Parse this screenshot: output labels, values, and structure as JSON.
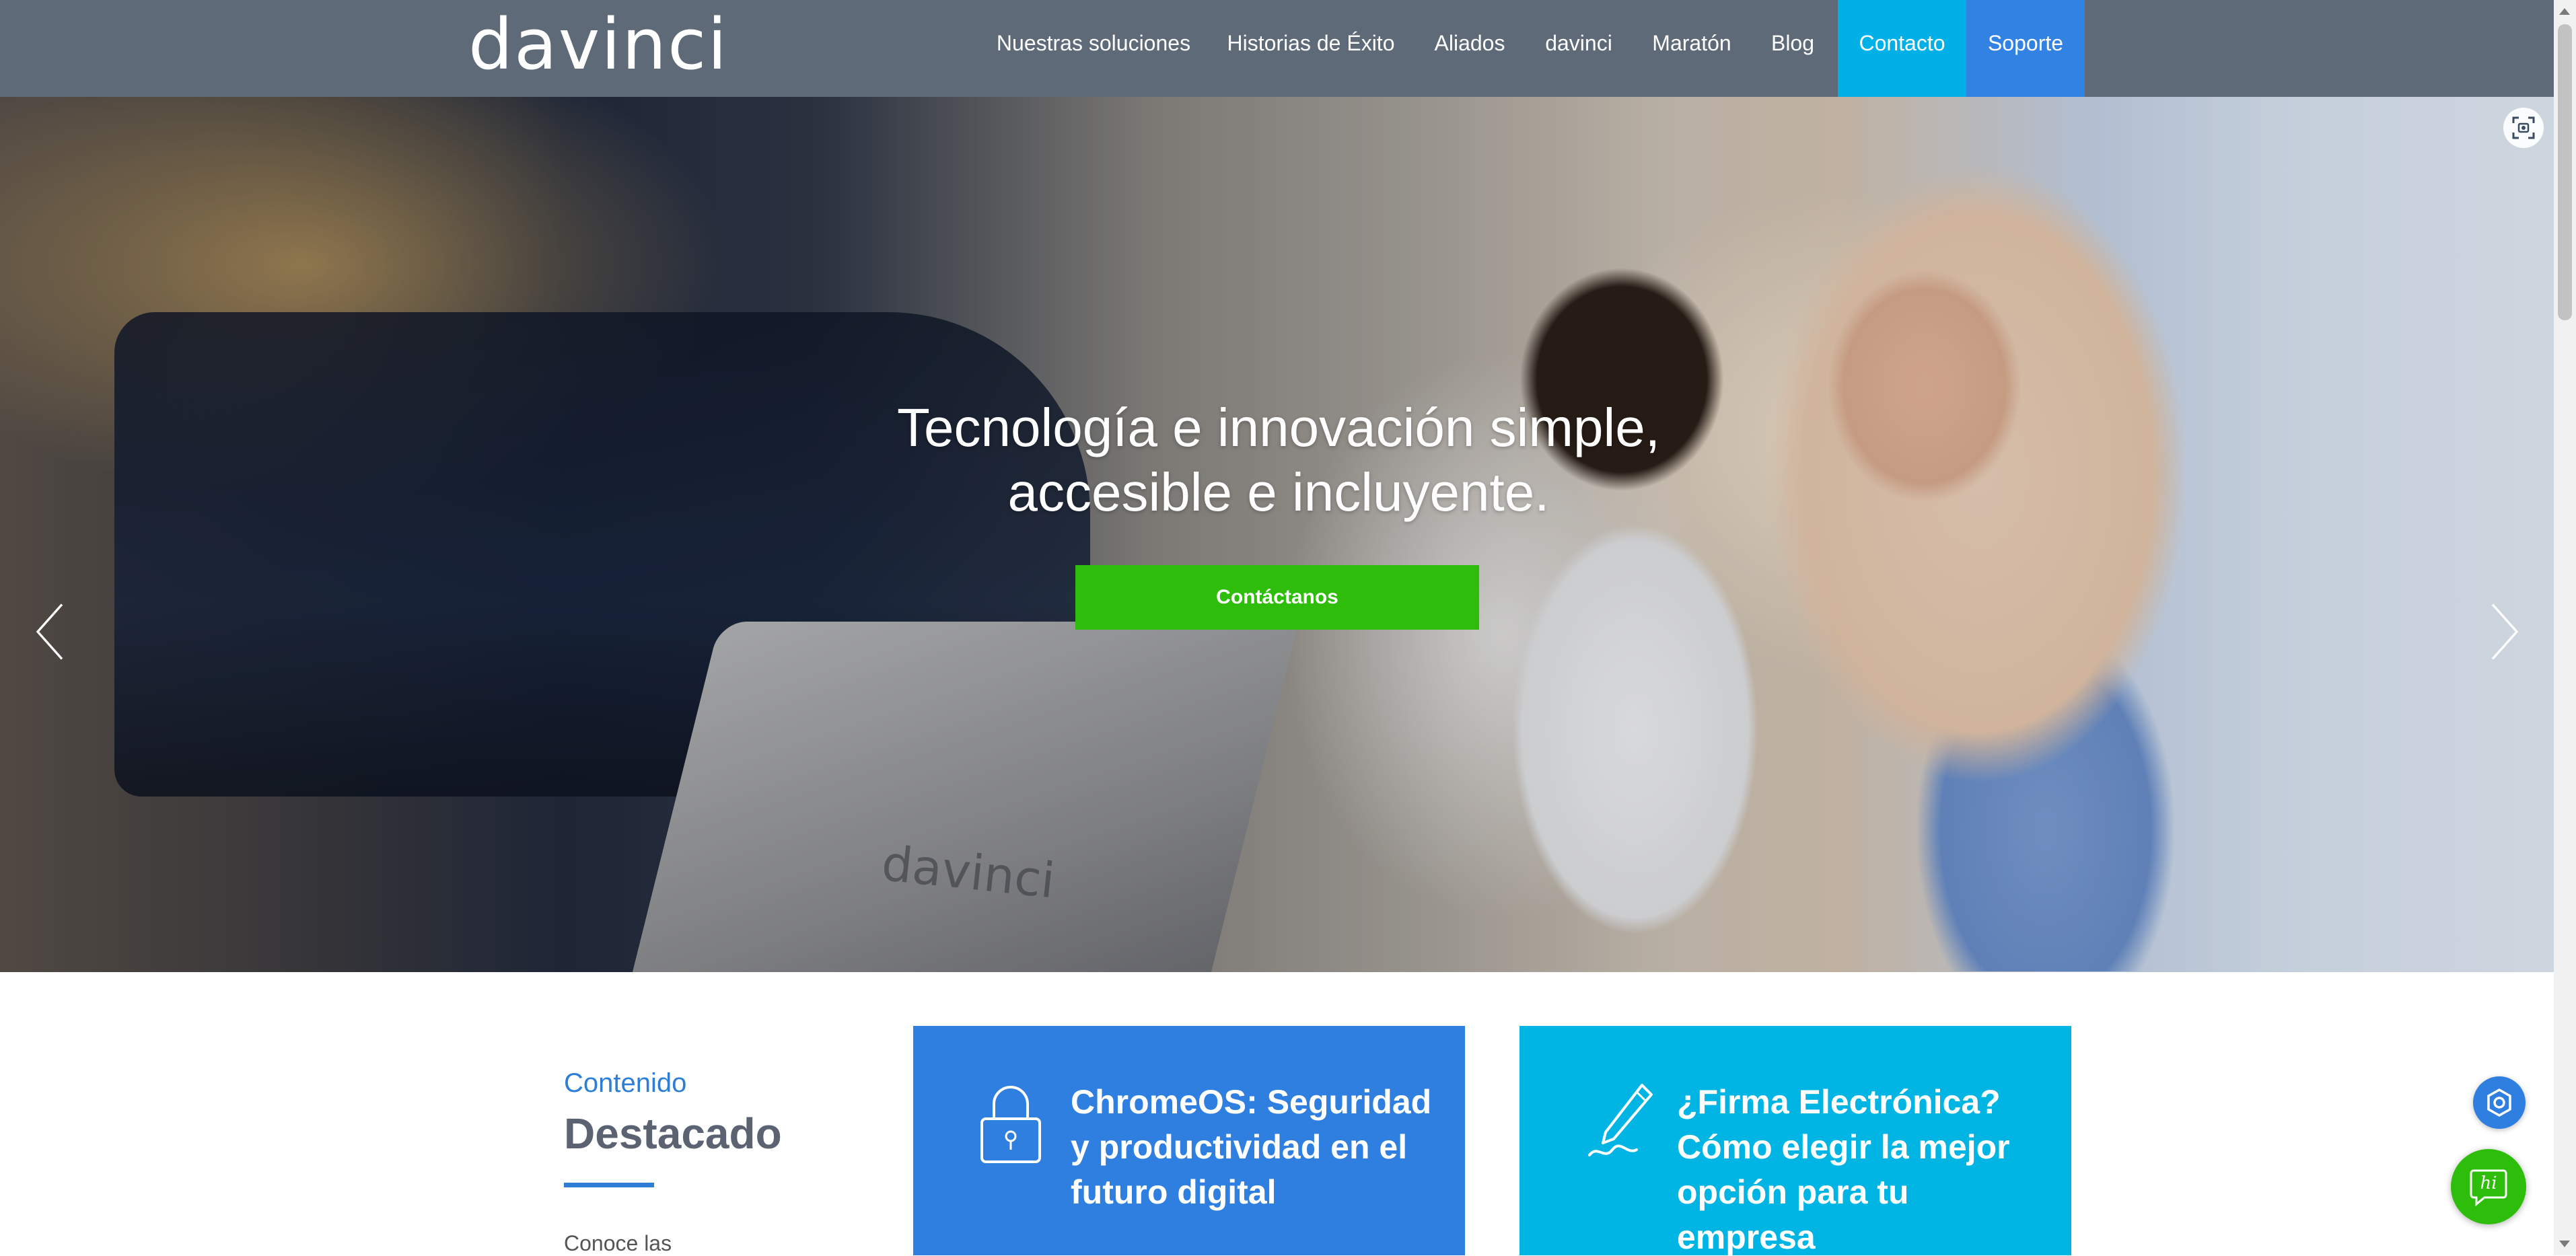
{
  "header": {
    "logo_text": "davinci",
    "nav": [
      {
        "label": "Nuestras soluciones"
      },
      {
        "label": "Historias de Éxito"
      },
      {
        "label": "Aliados"
      },
      {
        "label": "davinci"
      },
      {
        "label": "Maratón"
      },
      {
        "label": "Blog"
      },
      {
        "label": "Contacto"
      },
      {
        "label": "Soporte"
      }
    ],
    "colors": {
      "bar": "#5f6a78",
      "contacto": "#00b0e6",
      "soporte": "#3282e4"
    }
  },
  "hero": {
    "title_line1": "Tecnología e innovación simple,",
    "title_line2": "accesible e incluyente.",
    "cta_label": "Contáctanos",
    "laptop_logo": "davinci",
    "icons": {
      "prev": "chevron-left-icon",
      "next": "chevron-right-icon",
      "scan": "scan-icon"
    },
    "colors": {
      "cta": "#2ebd0b"
    }
  },
  "featured": {
    "subtitle": "Contenido",
    "title": "Destacado",
    "description": "Conoce las",
    "cards": [
      {
        "title": "ChromeOS: Seguridad y productividad en el futuro digital",
        "icon": "padlock-icon",
        "color": "#2f7fe0"
      },
      {
        "title": "¿Firma Electrónica? Cómo elegir la mejor opción para tu empresa",
        "icon": "pen-signature-icon",
        "color": "#00b4e4"
      }
    ]
  },
  "floating": {
    "accessibility_icon": "hexagon-gear-icon",
    "chat_icon": "chat-hi-icon",
    "chat_text": "hi"
  }
}
